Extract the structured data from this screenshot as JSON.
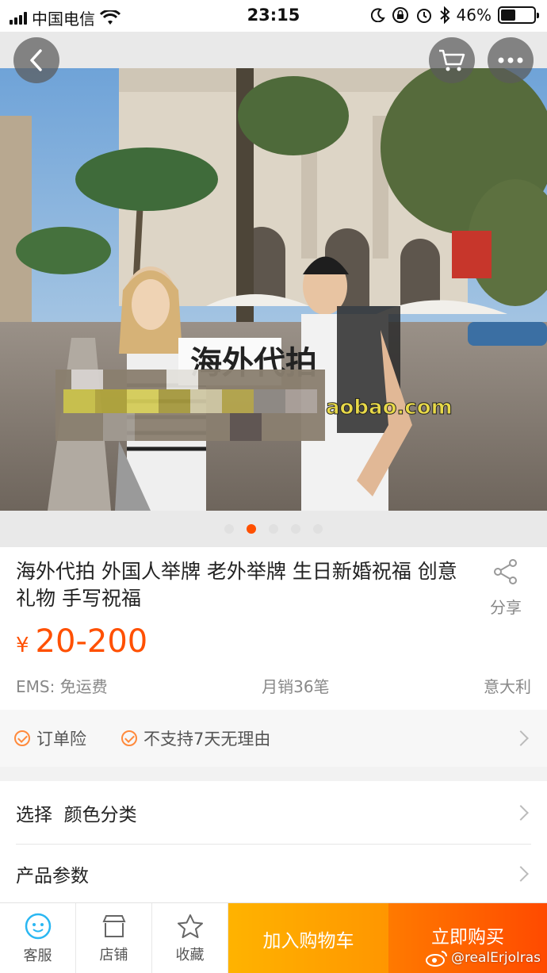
{
  "status_bar": {
    "carrier": "中国电信",
    "time": "23:15",
    "battery": "46%"
  },
  "product": {
    "title": "海外代拍 外国人举牌 老外举牌 生日新婚祝福 创意礼物 手写祝福",
    "share_label": "分享",
    "currency": "¥",
    "price": "20-200",
    "shipping": "EMS: 免运费",
    "monthly_sales": "月销36笔",
    "origin": "意大利",
    "photo_sign_text": "aobao.com",
    "active_slide": 1,
    "slide_count": 5
  },
  "guarantees": [
    "订单险",
    "不支持7天无理由"
  ],
  "options": {
    "select_label": "选择  颜色分类",
    "params_label": "产品参数"
  },
  "bottom_bar": {
    "service": "客服",
    "shop": "店铺",
    "favorite": "收藏",
    "add_to_cart": "加入购物车",
    "buy_now": "立即购买"
  },
  "watermark": "@realErjolras",
  "colors": {
    "accent": "#ff5000",
    "cart_button": "#ffa200",
    "buy_button": "#ff5a00"
  }
}
